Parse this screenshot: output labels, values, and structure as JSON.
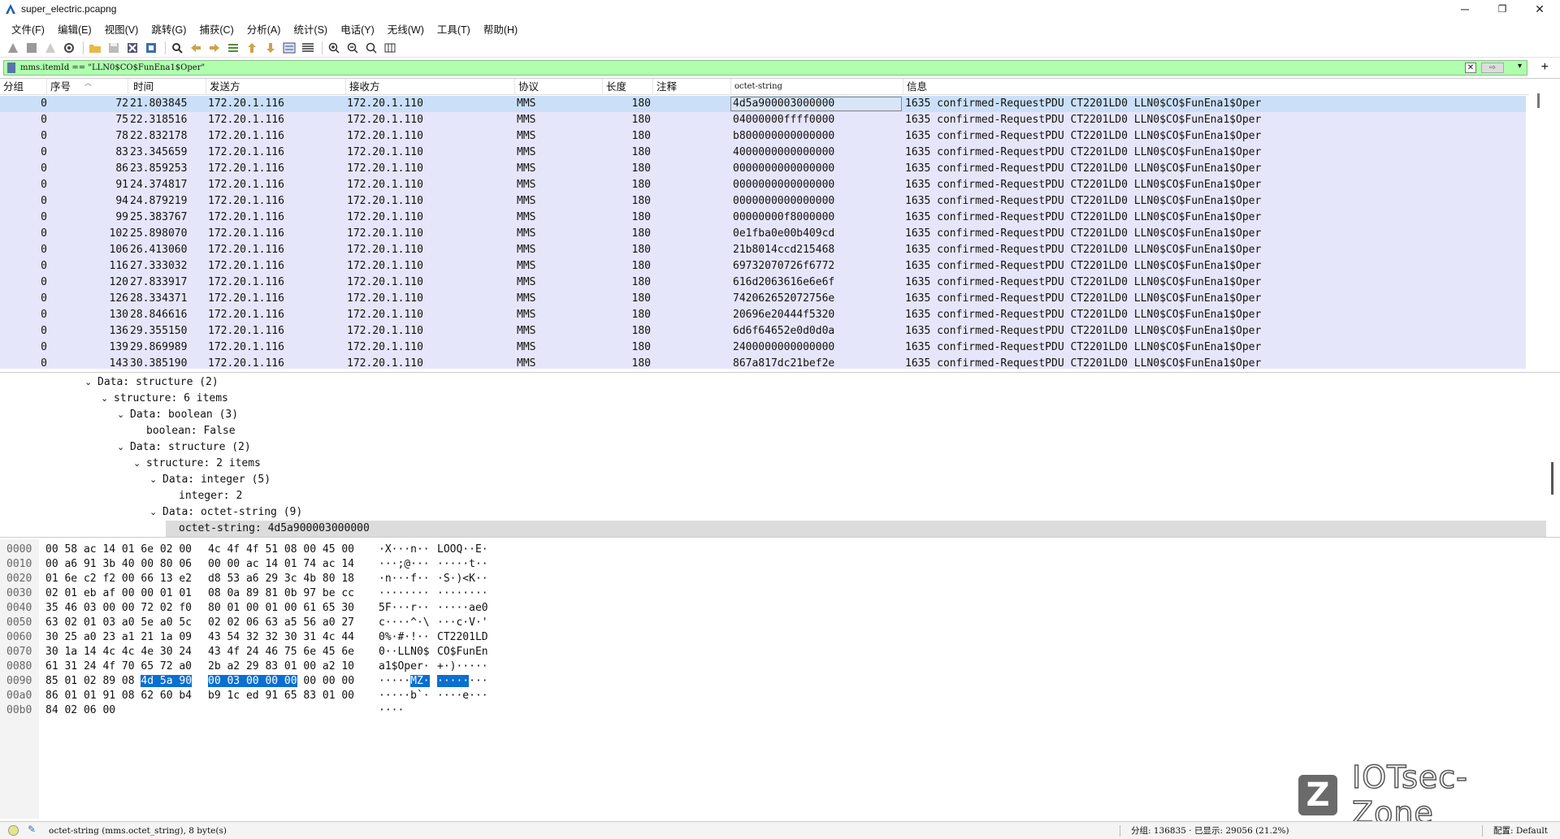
{
  "window": {
    "title": "super_electric.pcapng",
    "minimize": "─",
    "maximize": "❐",
    "close": "✕"
  },
  "menu": [
    "文件(F)",
    "编辑(E)",
    "视图(V)",
    "跳转(G)",
    "捕获(C)",
    "分析(A)",
    "统计(S)",
    "电话(Y)",
    "无线(W)",
    "工具(T)",
    "帮助(H)"
  ],
  "filter": {
    "value": "mms.itemId == \"LLN0$CO$FunEna1$Oper\""
  },
  "columns": {
    "group": "分组",
    "no": "序号",
    "time": "时间",
    "src": "发送方",
    "dst": "接收方",
    "proto": "协议",
    "len": "长度",
    "comment": "注释",
    "octet": "octet-string",
    "info": "信息"
  },
  "packets": [
    {
      "group": "0",
      "no": "72",
      "time": "21.803845",
      "src": "172.20.1.116",
      "dst": "172.20.1.110",
      "proto": "MMS",
      "len": "180",
      "octet": "4d5a900003000000",
      "info": "1635 confirmed-RequestPDU CT2201LD0 LLN0$CO$FunEna1$Oper"
    },
    {
      "group": "0",
      "no": "75",
      "time": "22.318516",
      "src": "172.20.1.116",
      "dst": "172.20.1.110",
      "proto": "MMS",
      "len": "180",
      "octet": "04000000ffff0000",
      "info": "1635 confirmed-RequestPDU CT2201LD0 LLN0$CO$FunEna1$Oper"
    },
    {
      "group": "0",
      "no": "78",
      "time": "22.832178",
      "src": "172.20.1.116",
      "dst": "172.20.1.110",
      "proto": "MMS",
      "len": "180",
      "octet": "b800000000000000",
      "info": "1635 confirmed-RequestPDU CT2201LD0 LLN0$CO$FunEna1$Oper"
    },
    {
      "group": "0",
      "no": "83",
      "time": "23.345659",
      "src": "172.20.1.116",
      "dst": "172.20.1.110",
      "proto": "MMS",
      "len": "180",
      "octet": "4000000000000000",
      "info": "1635 confirmed-RequestPDU CT2201LD0 LLN0$CO$FunEna1$Oper"
    },
    {
      "group": "0",
      "no": "86",
      "time": "23.859253",
      "src": "172.20.1.116",
      "dst": "172.20.1.110",
      "proto": "MMS",
      "len": "180",
      "octet": "0000000000000000",
      "info": "1635 confirmed-RequestPDU CT2201LD0 LLN0$CO$FunEna1$Oper"
    },
    {
      "group": "0",
      "no": "91",
      "time": "24.374817",
      "src": "172.20.1.116",
      "dst": "172.20.1.110",
      "proto": "MMS",
      "len": "180",
      "octet": "0000000000000000",
      "info": "1635 confirmed-RequestPDU CT2201LD0 LLN0$CO$FunEna1$Oper"
    },
    {
      "group": "0",
      "no": "94",
      "time": "24.879219",
      "src": "172.20.1.116",
      "dst": "172.20.1.110",
      "proto": "MMS",
      "len": "180",
      "octet": "0000000000000000",
      "info": "1635 confirmed-RequestPDU CT2201LD0 LLN0$CO$FunEna1$Oper"
    },
    {
      "group": "0",
      "no": "99",
      "time": "25.383767",
      "src": "172.20.1.116",
      "dst": "172.20.1.110",
      "proto": "MMS",
      "len": "180",
      "octet": "00000000f8000000",
      "info": "1635 confirmed-RequestPDU CT2201LD0 LLN0$CO$FunEna1$Oper"
    },
    {
      "group": "0",
      "no": "102",
      "time": "25.898070",
      "src": "172.20.1.116",
      "dst": "172.20.1.110",
      "proto": "MMS",
      "len": "180",
      "octet": "0e1fba0e00b409cd",
      "info": "1635 confirmed-RequestPDU CT2201LD0 LLN0$CO$FunEna1$Oper"
    },
    {
      "group": "0",
      "no": "106",
      "time": "26.413060",
      "src": "172.20.1.116",
      "dst": "172.20.1.110",
      "proto": "MMS",
      "len": "180",
      "octet": "21b8014ccd215468",
      "info": "1635 confirmed-RequestPDU CT2201LD0 LLN0$CO$FunEna1$Oper"
    },
    {
      "group": "0",
      "no": "116",
      "time": "27.333032",
      "src": "172.20.1.116",
      "dst": "172.20.1.110",
      "proto": "MMS",
      "len": "180",
      "octet": "69732070726f6772",
      "info": "1635 confirmed-RequestPDU CT2201LD0 LLN0$CO$FunEna1$Oper"
    },
    {
      "group": "0",
      "no": "120",
      "time": "27.833917",
      "src": "172.20.1.116",
      "dst": "172.20.1.110",
      "proto": "MMS",
      "len": "180",
      "octet": "616d2063616e6e6f",
      "info": "1635 confirmed-RequestPDU CT2201LD0 LLN0$CO$FunEna1$Oper"
    },
    {
      "group": "0",
      "no": "126",
      "time": "28.334371",
      "src": "172.20.1.116",
      "dst": "172.20.1.110",
      "proto": "MMS",
      "len": "180",
      "octet": "742062652072756e",
      "info": "1635 confirmed-RequestPDU CT2201LD0 LLN0$CO$FunEna1$Oper"
    },
    {
      "group": "0",
      "no": "130",
      "time": "28.846616",
      "src": "172.20.1.116",
      "dst": "172.20.1.110",
      "proto": "MMS",
      "len": "180",
      "octet": "20696e20444f5320",
      "info": "1635 confirmed-RequestPDU CT2201LD0 LLN0$CO$FunEna1$Oper"
    },
    {
      "group": "0",
      "no": "136",
      "time": "29.355150",
      "src": "172.20.1.116",
      "dst": "172.20.1.110",
      "proto": "MMS",
      "len": "180",
      "octet": "6d6f64652e0d0d0a",
      "info": "1635 confirmed-RequestPDU CT2201LD0 LLN0$CO$FunEna1$Oper"
    },
    {
      "group": "0",
      "no": "139",
      "time": "29.869989",
      "src": "172.20.1.116",
      "dst": "172.20.1.110",
      "proto": "MMS",
      "len": "180",
      "octet": "2400000000000000",
      "info": "1635 confirmed-RequestPDU CT2201LD0 LLN0$CO$FunEna1$Oper"
    },
    {
      "group": "0",
      "no": "143",
      "time": "30.385190",
      "src": "172.20.1.116",
      "dst": "172.20.1.110",
      "proto": "MMS",
      "len": "180",
      "octet": "867a817dc21bef2e",
      "info": "1635 confirmed-RequestPDU CT2201LD0 LLN0$CO$FunEna1$Oper"
    }
  ],
  "detail": [
    {
      "level": 0,
      "expanded": true,
      "text": "Data: structure (2)"
    },
    {
      "level": 1,
      "expanded": true,
      "text": "structure: 6 items"
    },
    {
      "level": 2,
      "expanded": true,
      "text": "Data: boolean (3)"
    },
    {
      "level": 3,
      "leaf": true,
      "text": "boolean: False"
    },
    {
      "level": 2,
      "expanded": true,
      "text": "Data: structure (2)"
    },
    {
      "level": 3,
      "expanded": true,
      "text": "structure: 2 items"
    },
    {
      "level": 4,
      "expanded": true,
      "text": "Data: integer (5)"
    },
    {
      "level": 5,
      "leaf": true,
      "text": "integer: 2"
    },
    {
      "level": 4,
      "expanded": true,
      "text": "Data: octet-string (9)"
    },
    {
      "level": 5,
      "leaf": true,
      "selected": true,
      "text": "octet-string: 4d5a900003000000"
    }
  ],
  "bytes": [
    {
      "off": "0000",
      "hex1": "00 58 ac 14 01 6e 02 00",
      "hex2": "4c 4f 4f 51 08 00 45 00",
      "asc1": "·X···n··",
      "asc2": "LOOQ··E·"
    },
    {
      "off": "0010",
      "hex1": "00 a6 91 3b 40 00 80 06",
      "hex2": "00 00 ac 14 01 74 ac 14",
      "asc1": "···;@···",
      "asc2": "·····t··"
    },
    {
      "off": "0020",
      "hex1": "01 6e c2 f2 00 66 13 e2",
      "hex2": "d8 53 a6 29 3c 4b 80 18",
      "asc1": "·n···f··",
      "asc2": "·S·)<K··"
    },
    {
      "off": "0030",
      "hex1": "02 01 eb af 00 00 01 01",
      "hex2": "08 0a 89 81 0b 97 be cc",
      "asc1": "········",
      "asc2": "········"
    },
    {
      "off": "0040",
      "hex1": "35 46 03 00 00 72 02 f0",
      "hex2": "80 01 00 01 00 61 65 30",
      "asc1": "5F···r··",
      "asc2": "·····ae0"
    },
    {
      "off": "0050",
      "hex1": "63 02 01 03 a0 5e a0 5c",
      "hex2": "02 02 06 63 a5 56 a0 27",
      "asc1": "c····^·\\",
      "asc2": "···c·V·'"
    },
    {
      "off": "0060",
      "hex1": "30 25 a0 23 a1 21 1a 09",
      "hex2": "43 54 32 32 30 31 4c 44",
      "asc1": "0%·#·!··",
      "asc2": "CT2201LD"
    },
    {
      "off": "0070",
      "hex1": "30 1a 14 4c 4c 4e 30 24",
      "hex2": "43 4f 24 46 75 6e 45 6e",
      "asc1": "0··LLN0$",
      "asc2": "CO$FunEn"
    },
    {
      "off": "0080",
      "hex1": "61 31 24 4f 70 65 72 a0",
      "hex2": "2b a2 29 83 01 00 a2 10",
      "asc1": "a1$Oper·",
      "asc2": "+·)·····"
    },
    {
      "off": "0090",
      "hex1a": "85 01 02 89 08 ",
      "hex1b": "4d 5a 90",
      "hex2a": "00 03 00 00 00",
      "hex2b": " 00 00 00",
      "asc1a": "·····",
      "asc1b": "MZ·",
      "asc2a": "·····",
      "asc2b": "···"
    },
    {
      "off": "00a0",
      "hex1": "86 01 01 91 08 62 60 b4",
      "hex2": "b9 1c ed 91 65 83 01 00",
      "asc1": "·····b`·",
      "asc2": "····e···"
    },
    {
      "off": "00b0",
      "hex1": "84 02 06 00",
      "hex2": "",
      "asc1": "····",
      "asc2": ""
    }
  ],
  "watermark": {
    "logo": "Z",
    "text": "IOTsec-Zone"
  },
  "status": {
    "field": "octet-string (mms.octet_string), 8 byte(s)",
    "counts": "分组: 136835 · 已显示: 29056 (21.2%)",
    "profile": "配置: Default"
  }
}
